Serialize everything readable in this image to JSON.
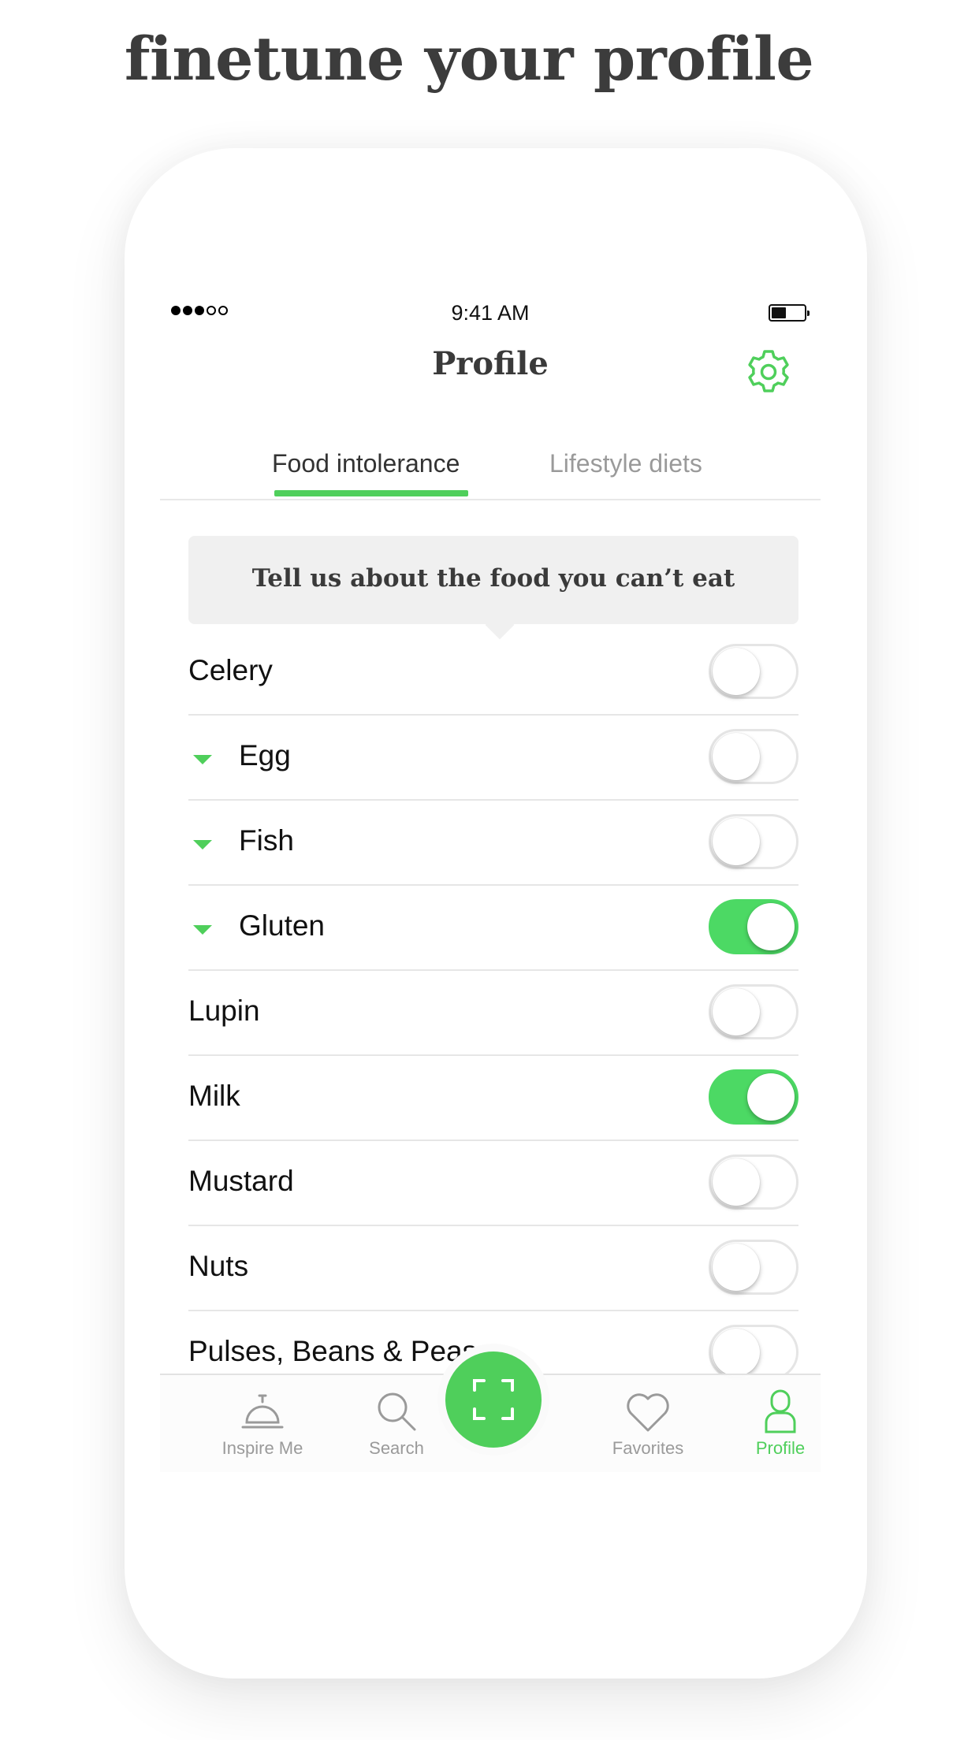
{
  "headline": "finetune your profile",
  "status_bar": {
    "time": "9:41 AM",
    "signal_bars_filled": 3,
    "signal_bars_total": 5
  },
  "nav": {
    "title": "Profile",
    "settings_icon": "gear-icon"
  },
  "tabs": [
    {
      "label": "Food intolerance",
      "active": true
    },
    {
      "label": "Lifestyle diets",
      "active": false
    }
  ],
  "banner": {
    "text": "Tell us about the food you can’t eat"
  },
  "intolerances": [
    {
      "label": "Celery",
      "expandable": false,
      "enabled": false
    },
    {
      "label": "Egg",
      "expandable": true,
      "enabled": false
    },
    {
      "label": "Fish",
      "expandable": true,
      "enabled": false
    },
    {
      "label": "Gluten",
      "expandable": true,
      "enabled": true
    },
    {
      "label": "Lupin",
      "expandable": false,
      "enabled": false
    },
    {
      "label": "Milk",
      "expandable": false,
      "enabled": true
    },
    {
      "label": "Mustard",
      "expandable": false,
      "enabled": false
    },
    {
      "label": "Nuts",
      "expandable": false,
      "enabled": false
    },
    {
      "label": "Pulses, Beans & Peas",
      "expandable": false,
      "enabled": false
    }
  ],
  "tab_bar": [
    {
      "label": "Inspire Me",
      "icon": "service-bell-icon",
      "active": false
    },
    {
      "label": "Search",
      "icon": "search-icon",
      "active": false
    },
    {
      "label": "",
      "icon": "scan-icon",
      "active": false
    },
    {
      "label": "Favorites",
      "icon": "heart-icon",
      "active": false
    },
    {
      "label": "Profile",
      "icon": "profile-icon",
      "active": true
    }
  ],
  "colors": {
    "accent": "#4fcf5b",
    "toggle_on": "#4cd964",
    "text": "#111111",
    "muted": "#9a9a9a"
  }
}
